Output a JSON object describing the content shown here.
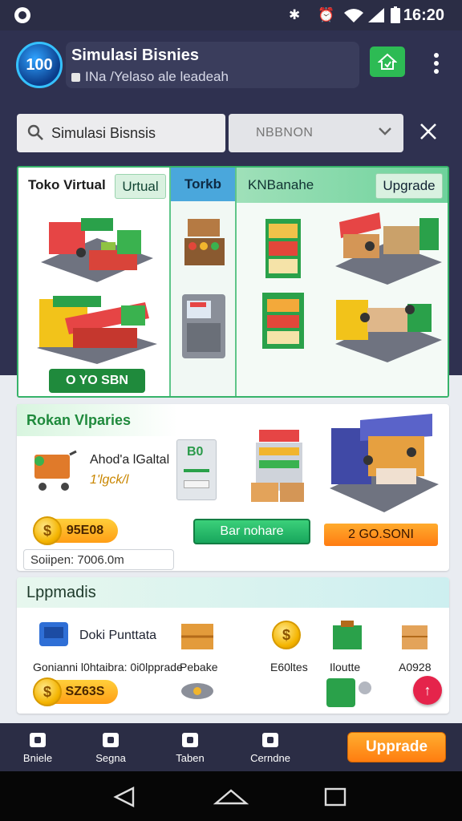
{
  "status_bar": {
    "time": "16:20"
  },
  "header": {
    "logo_text": "100",
    "title": "Simulasi Bisnies",
    "subtitle": "INa /Yelaso ale leadeah"
  },
  "search": {
    "text": "Simulasi Bisnsis",
    "dropdown_value": "NBBNON"
  },
  "panel": {
    "col1_title": "Toko Virtual",
    "col1_tag": "Urtual",
    "col2_title": "Torkb",
    "col3_title": "KNBanahe",
    "col3_tag": "Upgrade",
    "buy_button": "O YO SBN"
  },
  "card2": {
    "title": "Rokan Vlparies",
    "item_label": "Ahod'a lGaltal",
    "item_value": "1'lgck/l",
    "coin_value": "95E08",
    "green_button": "Bar nohare",
    "orange_button": "2 GO.SONI",
    "input_text": "Soiipen: 7006.0m",
    "screen_text": "B0"
  },
  "card3": {
    "title": "Lppmadis",
    "item_title": "Doki Punttata",
    "labels": [
      "Gonianni l0htaibra: 0i0lpprade",
      "Pebake",
      "E60ltes",
      "Iloutte",
      "A0928"
    ],
    "coin_value": "SZ63S"
  },
  "bottom_nav": {
    "items": [
      "Bniele",
      "Segna",
      "Taben",
      "Cerndne"
    ],
    "upgrade_button": "Upprade"
  },
  "colors": {
    "header_bg": "#2f3150",
    "accent_green": "#1f8a3c",
    "accent_orange": "#ff8a16",
    "panel_border": "#37b36a"
  }
}
